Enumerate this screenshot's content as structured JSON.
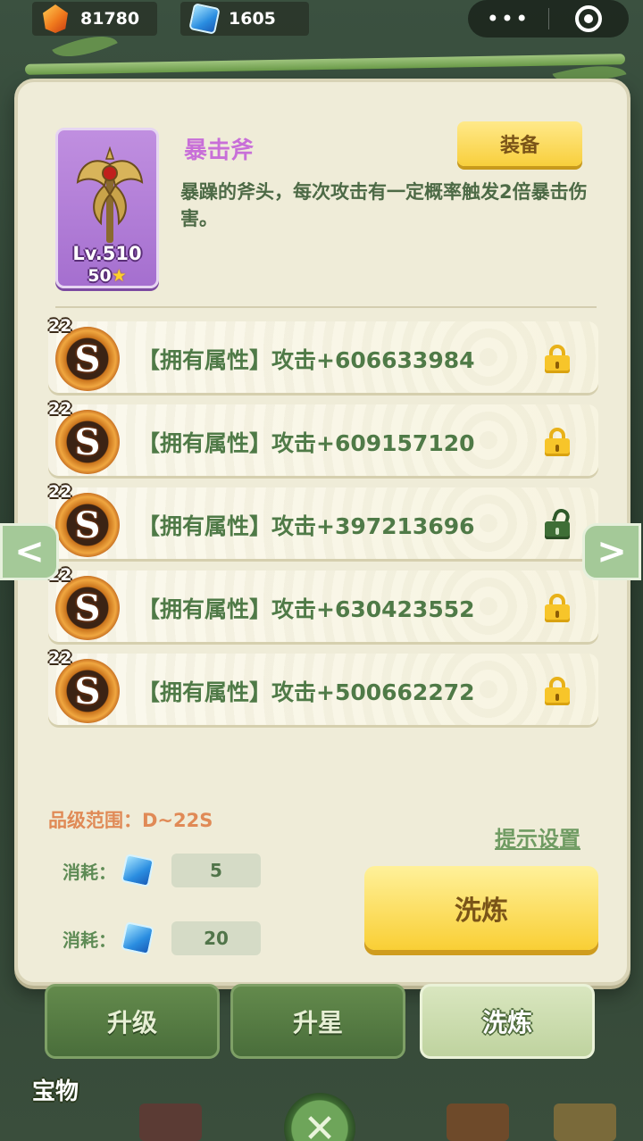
{
  "resources": [
    {
      "icon": "fire-gem-icon",
      "value": "81780"
    },
    {
      "icon": "blue-crystal-icon",
      "value": "1605"
    }
  ],
  "capsule": {
    "more": "•••"
  },
  "item": {
    "name": "暴击斧",
    "level": "Lv.510",
    "stars": "50",
    "star_glyph": "★",
    "description": "暴躁的斧头，每次攻击有一定概率触发2倍暴击伤害。",
    "equip_label": "装备"
  },
  "attributes": [
    {
      "grade": "22",
      "letter": "S",
      "text": "【拥有属性】攻击+606633984",
      "locked": true
    },
    {
      "grade": "22",
      "letter": "S",
      "text": "【拥有属性】攻击+609157120",
      "locked": true
    },
    {
      "grade": "22",
      "letter": "S",
      "text": "【拥有属性】攻击+397213696",
      "locked": false
    },
    {
      "grade": "22",
      "letter": "S",
      "text": "【拥有属性】攻击+630423552",
      "locked": true
    },
    {
      "grade": "22",
      "letter": "S",
      "text": "【拥有属性】攻击+500662272",
      "locked": true
    }
  ],
  "nav": {
    "prev": "<",
    "next": ">"
  },
  "grade_range": "品级范围：D~22S",
  "tip_settings": "提示设置",
  "costs": [
    {
      "label": "消耗：",
      "value": "5"
    },
    {
      "label": "消耗：",
      "value": "20"
    }
  ],
  "refine_label": "洗炼",
  "tabs": [
    {
      "label": "升级",
      "active": false
    },
    {
      "label": "升星",
      "active": false
    },
    {
      "label": "洗炼",
      "active": true
    }
  ],
  "treasure_label": "宝物",
  "close_glyph": "✕",
  "colors": {
    "accent_purple": "#c86fd8",
    "text_green": "#4f7a47",
    "lock_gold": "#f7c52a",
    "lock_open_green": "#3e6e36"
  }
}
